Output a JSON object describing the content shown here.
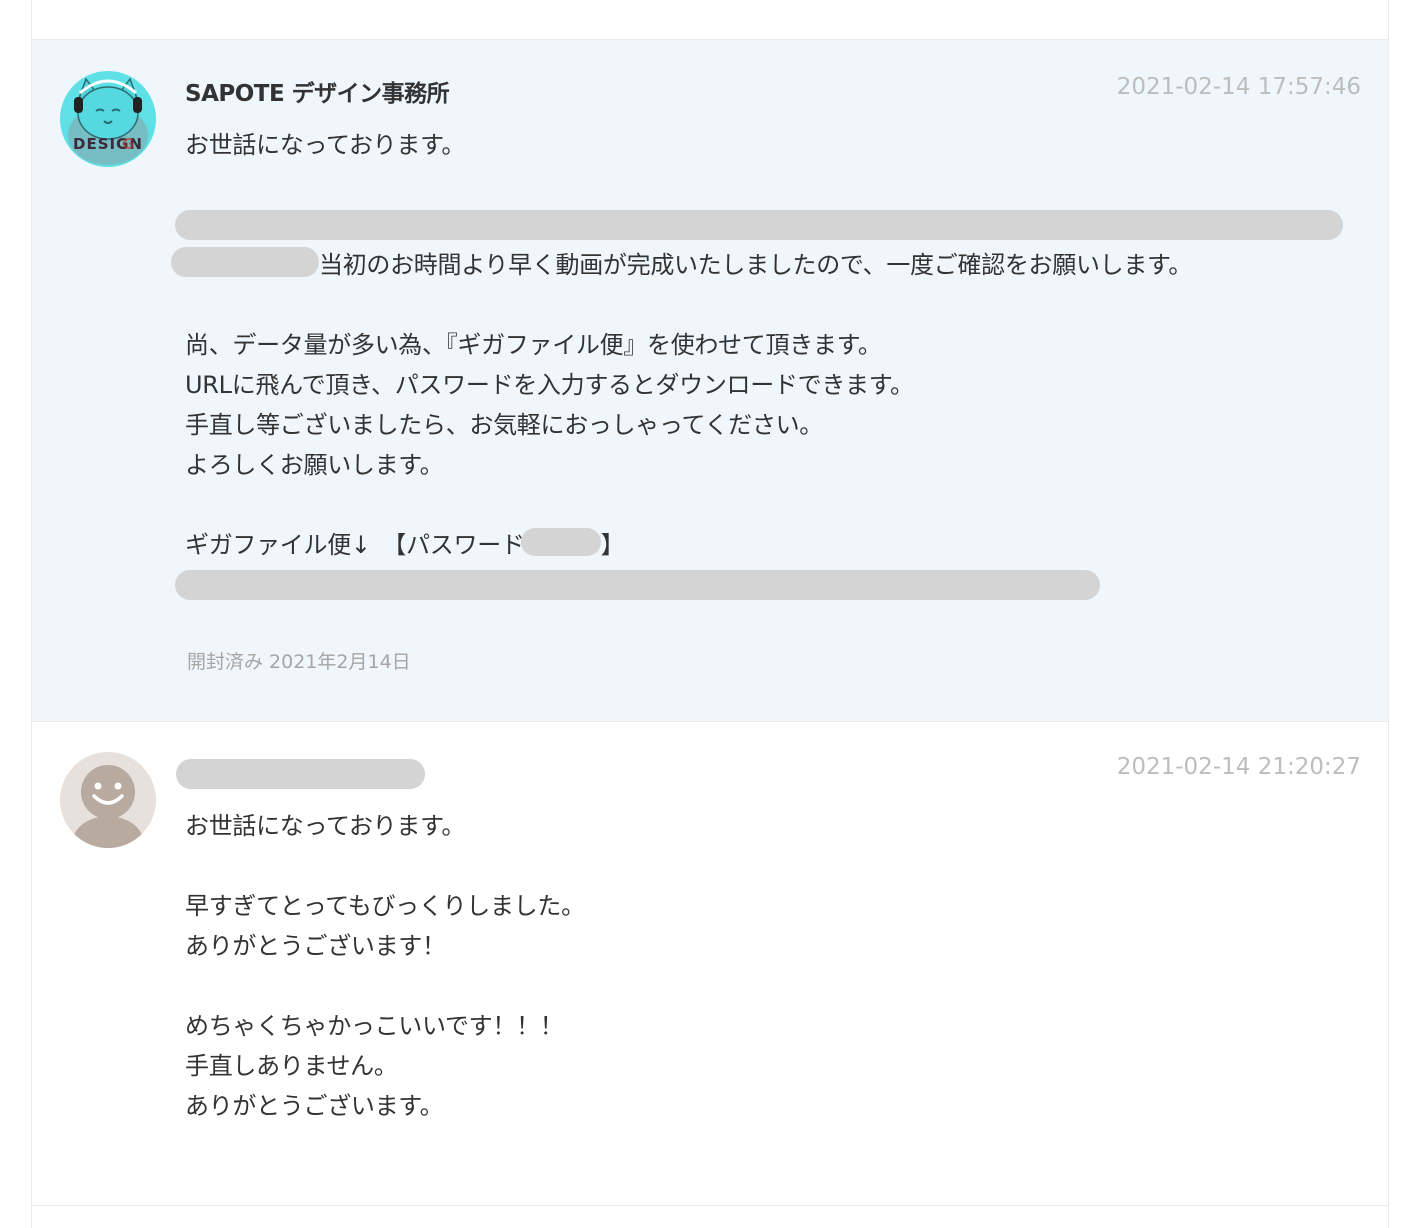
{
  "messages": [
    {
      "sender": "SAPOTE デザイン事務所",
      "timestamp": "2021-02-14 17:57:46",
      "avatar_icon": "design-cat-avatar-icon",
      "lines": {
        "l1": "お世話になっております。",
        "l4": "当初のお時間より早く動画が完成いたしましたので、一度ご確認をお願いします。",
        "l6": "尚、データ量が多い為、『ギガファイル便』を使わせて頂きます。",
        "l7": "URLに飛んで頂き、パスワードを入力するとダウンロードできます。",
        "l8": "手直し等ございましたら、お気軽におっしゃってください。",
        "l9": "よろしくお願いします。",
        "l11a": "ギガファイル便↓　【パスワード",
        "l11b": "】"
      },
      "read_status": "開封済み 2021年2月14日"
    },
    {
      "sender": "",
      "timestamp": "2021-02-14 21:20:27",
      "avatar_icon": "default-user-avatar-icon",
      "lines": {
        "l1": "お世話になっております。",
        "l3": "早すぎてとってもびっくりしました。",
        "l4": "ありがとうございます！",
        "l6": "めちゃくちゃかっこいいです！！！",
        "l7": "手直しありません。",
        "l8": "ありがとうございます。"
      }
    }
  ],
  "colors": {
    "highlight_bg": "#eff7fd",
    "redaction": "#d4d4d5",
    "timestamp": "#bdbdbd",
    "read_status": "#a5a5a5"
  }
}
